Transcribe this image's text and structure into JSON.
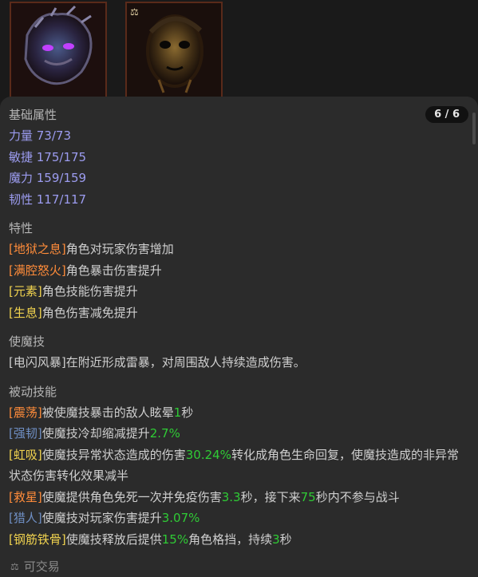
{
  "items": [
    {
      "icon": "dark-flower-mask-icon"
    },
    {
      "icon": "golden-mask-icon",
      "badge": "⚖"
    }
  ],
  "page_counter": "6 / 6",
  "base_attributes": {
    "title": "基础属性",
    "stats": [
      "力量 73/73",
      "敏捷 175/175",
      "魔力 159/159",
      "韧性 117/117"
    ]
  },
  "traits": {
    "title": "特性",
    "items": [
      {
        "tag": "[地狱之息]",
        "text": "角色对玩家伤害增加"
      },
      {
        "tag": "[满腔怒火]",
        "text": "角色暴击伤害提升"
      },
      {
        "tag": "[元素]",
        "text": "角色技能伤害提升"
      },
      {
        "tag": "[生息]",
        "text": "角色伤害减免提升"
      }
    ]
  },
  "skill": {
    "title": "使魔技",
    "desc": "[电闪风暴]在附近形成雷暴，对周围敌人持续造成伤害。"
  },
  "passive": {
    "title": "被动技能",
    "items": [
      {
        "tag": "[震荡]",
        "p1": "被使魔技暴击的敌人眩晕",
        "n1": "1",
        "p2": "秒"
      },
      {
        "tag": "[强韧]",
        "p1": "使魔技冷却缩减提升",
        "n1": "2.7%"
      },
      {
        "tag": "[虹吸]",
        "p1": "使魔技异常状态造成的伤害",
        "n1": "30.24%",
        "p2": "转化成角色生命回复，使魔技造成的非异常状态伤害转化效果减半"
      },
      {
        "tag": "[救星]",
        "p1": "使魔提供角色免死一次并免疫伤害",
        "n1": "3.3",
        "p2": "秒，接下来",
        "n2": "75",
        "p3": "秒内不参与战斗"
      },
      {
        "tag": "[猎人]",
        "p1": "使魔技对玩家伤害提升",
        "n1": "3.07%"
      },
      {
        "tag": "[钢筋铁骨]",
        "p1": "使魔技释放后提供",
        "n1": "15%",
        "p2": "角色格挡，持续",
        "n2": "3",
        "p3": "秒"
      }
    ]
  },
  "footer": {
    "icon": "trade-icon",
    "label": "可交易"
  }
}
